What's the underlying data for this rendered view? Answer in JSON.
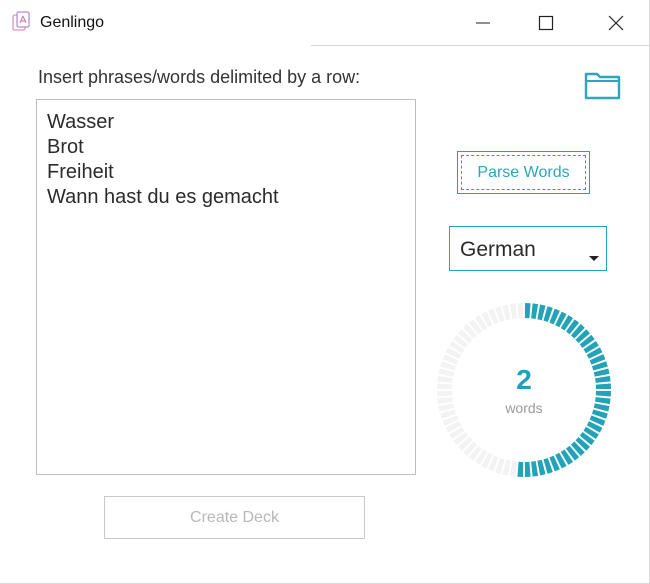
{
  "window": {
    "title": "Genlingo",
    "controls": [
      "minimize-icon",
      "maximize-icon",
      "close-icon"
    ]
  },
  "main": {
    "instruction": "Insert phrases/words delimited by a row:",
    "folder_icon": "folder-icon",
    "input_text": "Wasser\nBrot\nFreiheit\nWann hast du es gemacht",
    "parse_button_label": "Parse Words",
    "language_select": {
      "selected": "German"
    },
    "word_counter": {
      "value": "2",
      "label": "words",
      "fill_fraction": 0.52
    },
    "create_button_label": "Create Deck"
  },
  "colors": {
    "accent": "#23a3b8",
    "gauge_track": "#f3f3f3",
    "disabled_text": "#b8b8b8"
  }
}
